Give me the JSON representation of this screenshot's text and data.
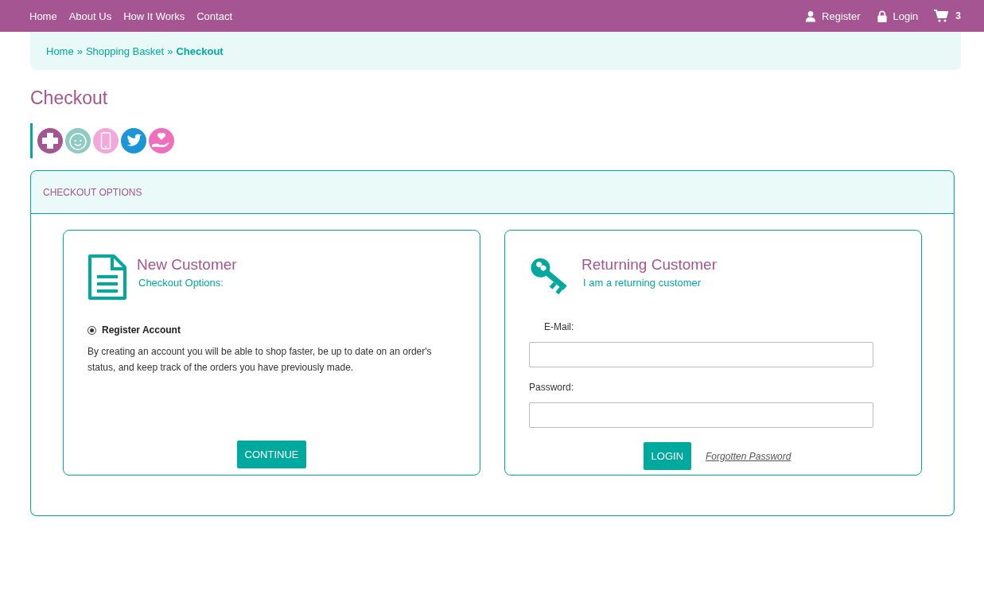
{
  "nav": {
    "links": [
      "Home",
      "About Us",
      "How It Works",
      "Contact"
    ],
    "register": "Register",
    "login": "Login",
    "cart_count": "3"
  },
  "breadcrumb": [
    {
      "label": "Home",
      "current": false
    },
    {
      "label": "Shopping Basket",
      "current": false
    },
    {
      "label": "Checkout",
      "current": true
    }
  ],
  "breadcrumb_separator": "»",
  "page_title": "Checkout",
  "panel_heading": "CHECKOUT OPTIONS",
  "new_customer": {
    "title": "New Customer",
    "subtitle": "Checkout Options:",
    "options": [
      {
        "label": "Register Account",
        "selected": true
      }
    ],
    "description": "By creating an account you will be able to shop faster, be up to date on an order's status, and keep track of the orders you have previously made.",
    "button": "CONTINUE"
  },
  "returning_customer": {
    "title": "Returning Customer",
    "subtitle": "I am a returning customer",
    "email_label": "E-Mail:",
    "password_label": "Password:",
    "button": "LOGIN",
    "forgot_link": "Forgotten Password"
  }
}
